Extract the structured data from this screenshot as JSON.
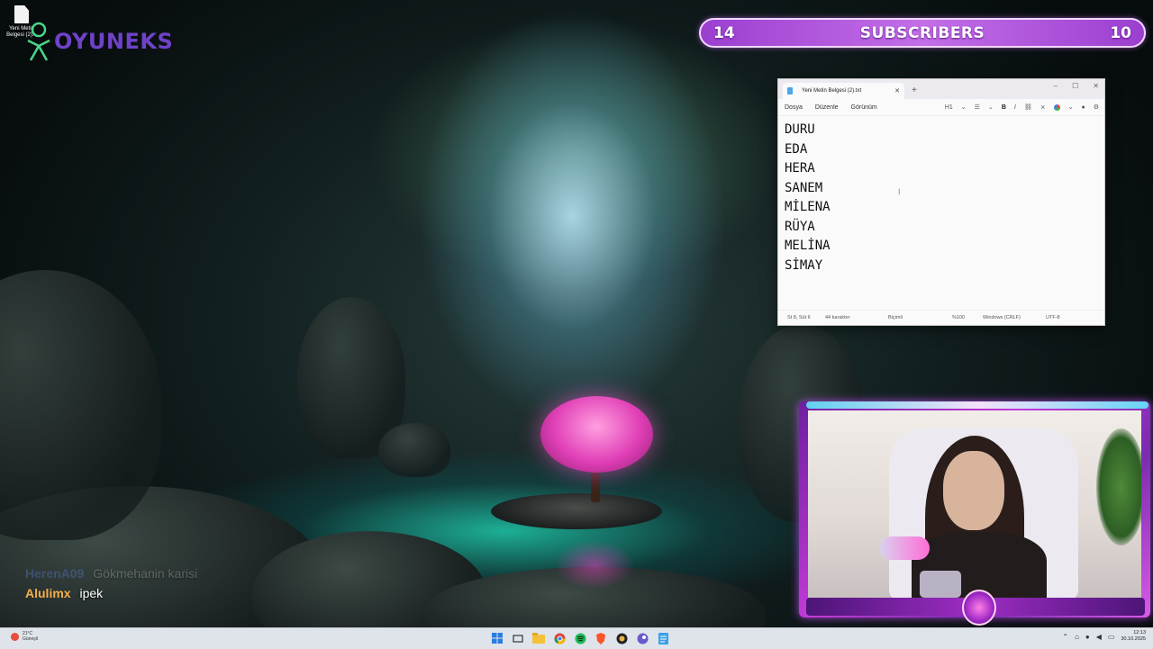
{
  "desktop": {
    "icon_label": "Yeni Metin Belgesi (2)..."
  },
  "logo": {
    "text": "OYUNEKS"
  },
  "subscriber_bar": {
    "left_count": "14",
    "label": "SUBSCRIBERS",
    "right_count": "10",
    "colors": {
      "fill": "#b55be0",
      "border": "#f1d8ff"
    }
  },
  "notepad": {
    "tab_title": "Yeni Metin Belgesi (2).txt",
    "menu": [
      "Dosya",
      "Düzenle",
      "Görünüm"
    ],
    "toolbar": {
      "heading": "H1",
      "bold": "B",
      "italic": "I"
    },
    "lines": [
      "DURU",
      "EDA",
      "HERA",
      "SANEM",
      "MİLENA",
      "RÜYA",
      "MELİNA",
      "SİMAY"
    ],
    "status": {
      "position": "St 8, Süt 6",
      "chars": "44 karakter",
      "format": "Biçimli",
      "zoom": "%100",
      "line_endings": "Windows (CRLF)",
      "encoding": "UTF-8"
    }
  },
  "chat": [
    {
      "user": "HerenA09",
      "message": "Gökmehanin karisi"
    },
    {
      "user": "Alulimx",
      "message": "ipek"
    }
  ],
  "taskbar": {
    "weather_temp": "21°C",
    "weather_desc": "Güneşli",
    "time": "12:13",
    "date": "30.10.2025",
    "apps": [
      "windows-start-icon",
      "task-view-icon",
      "file-explorer-icon",
      "chrome-icon",
      "spotify-icon",
      "brave-icon",
      "app-icon",
      "steam-icon",
      "notepad-icon"
    ]
  }
}
